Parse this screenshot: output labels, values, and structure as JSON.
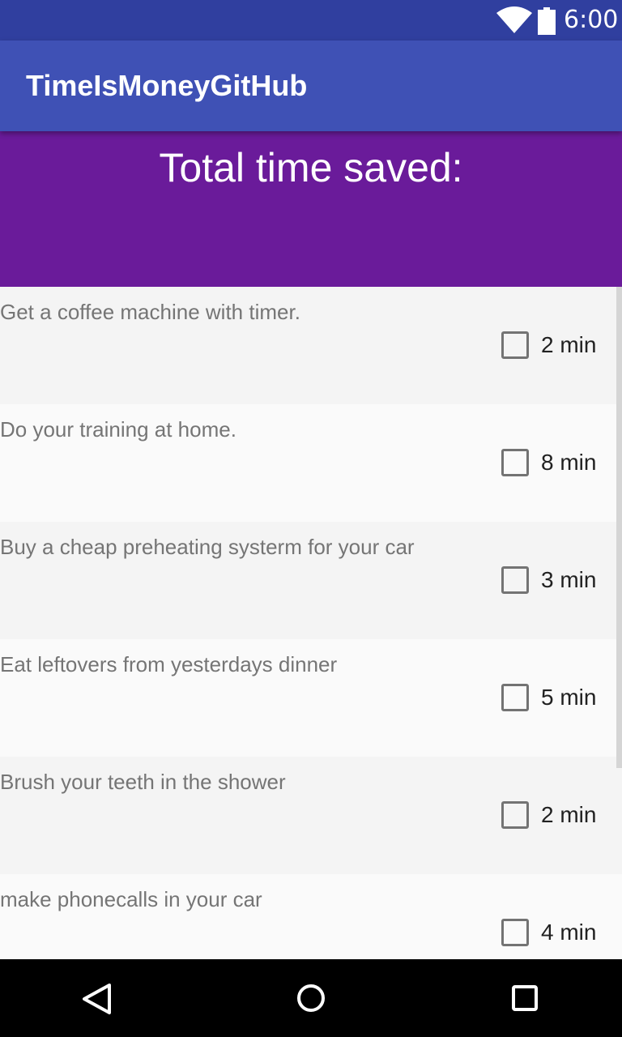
{
  "status_bar": {
    "time": "6:00",
    "icons": [
      "wifi-icon",
      "battery-icon"
    ]
  },
  "app_bar": {
    "title": "TimeIsMoneyGitHub"
  },
  "summary": {
    "label": "Total time saved:",
    "background": "#6a1b9a"
  },
  "colors": {
    "status_bar": "#303f9f",
    "app_bar": "#3f51b5",
    "accent": "#6a1b9a"
  },
  "tips": [
    {
      "text": "Get a coffee machine with timer.",
      "minutes": "2 min",
      "checked": false
    },
    {
      "text": "Do your training at home.",
      "minutes": "8 min",
      "checked": false
    },
    {
      "text": "Buy a cheap preheating systerm for your car",
      "minutes": "3 min",
      "checked": false
    },
    {
      "text": "Eat leftovers from yesterdays dinner",
      "minutes": "5 min",
      "checked": false
    },
    {
      "text": "Brush your teeth in the shower",
      "minutes": "2 min",
      "checked": false
    },
    {
      "text": "make phonecalls in your car",
      "minutes": "4 min",
      "checked": false
    }
  ],
  "nav_bar": {
    "buttons": [
      "back-icon",
      "home-icon",
      "recent-apps-icon"
    ]
  }
}
